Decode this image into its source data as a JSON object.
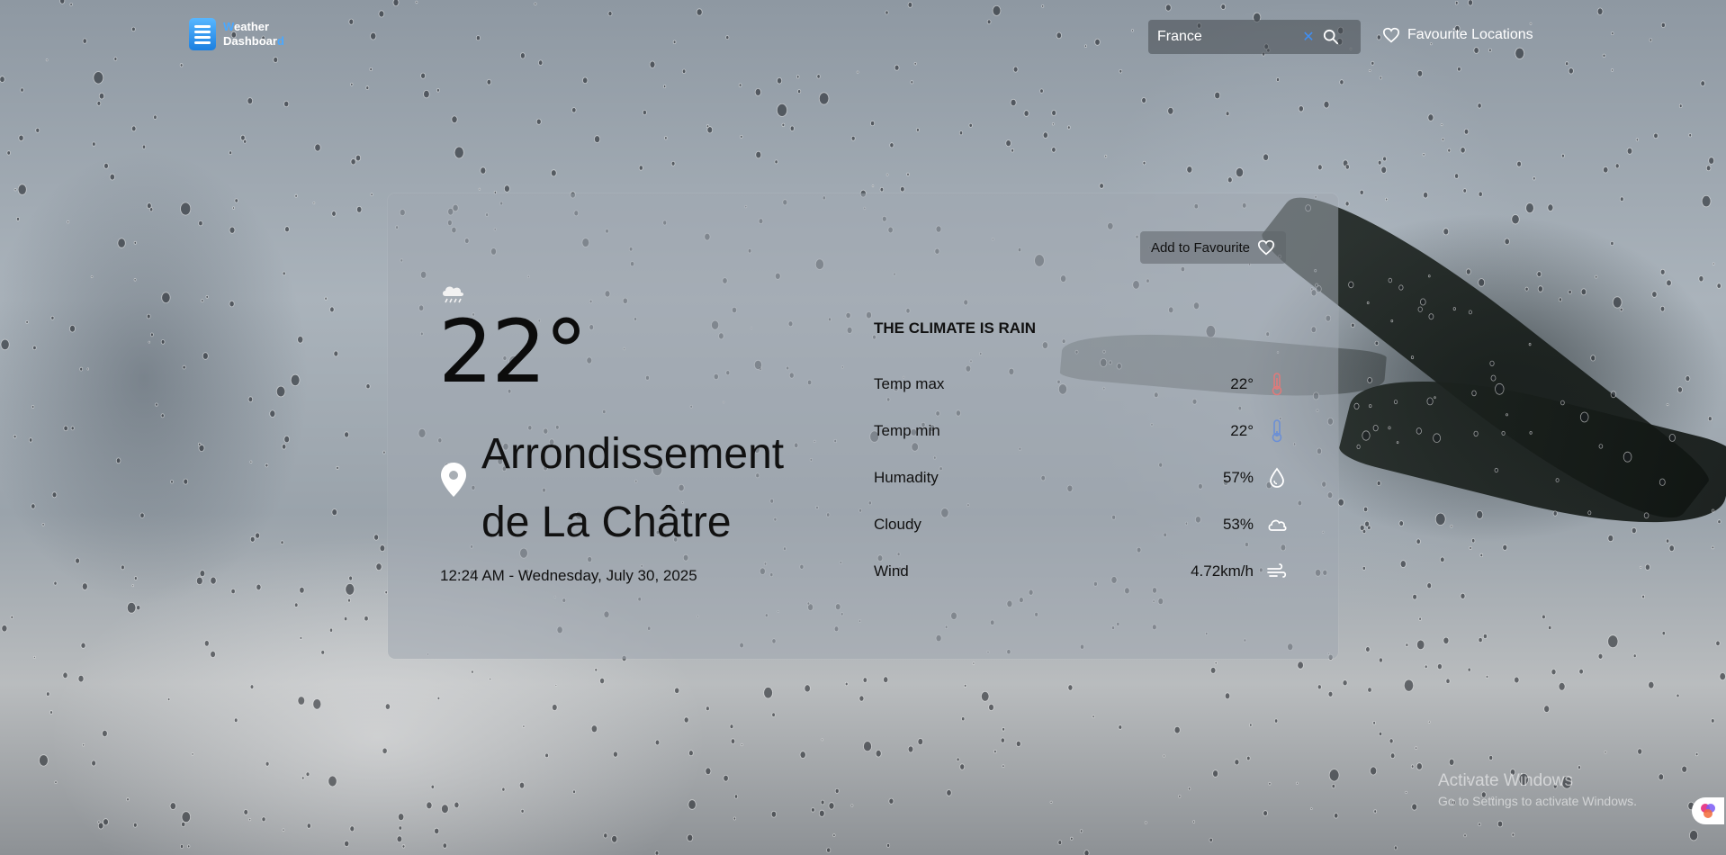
{
  "header": {
    "logo_line1_main": "W",
    "logo_line1_rest": "eather",
    "logo_line2_main": "Dashboar",
    "logo_line2_accent": "d",
    "search": {
      "value": "France",
      "placeholder": ""
    },
    "clear_symbol": "✕",
    "favourites_label": "Favourite Locations"
  },
  "card": {
    "add_favourite_label": "Add to Favourite",
    "weather_icon": "rain-cloud-icon",
    "temperature": "22°",
    "location_line1": "Arrondissement",
    "location_line2": "de La Châtre",
    "datetime": "12:24 AM - Wednesday, July 30, 2025",
    "climate_title": "THE CLIMATE IS RAIN",
    "details": [
      {
        "label": "Temp max",
        "value": "22°",
        "icon": "thermometer-hot-icon",
        "color": "#e07a7a"
      },
      {
        "label": "Temp min",
        "value": "22°",
        "icon": "thermometer-cold-icon",
        "color": "#6b8fd6"
      },
      {
        "label": "Humadity",
        "value": "57%",
        "icon": "droplet-icon",
        "color": "#ffffff"
      },
      {
        "label": "Cloudy",
        "value": "53%",
        "icon": "cloud-icon",
        "color": "#ffffff"
      },
      {
        "label": "Wind",
        "value": "4.72km/h",
        "icon": "wind-icon",
        "color": "#ffffff"
      }
    ]
  },
  "watermark": {
    "title": "Activate Windows",
    "subtitle": "Go to Settings to activate Windows."
  },
  "colors": {
    "accent": "#3f8ff5",
    "card_bg": "rgba(160,168,176,0.55)"
  }
}
